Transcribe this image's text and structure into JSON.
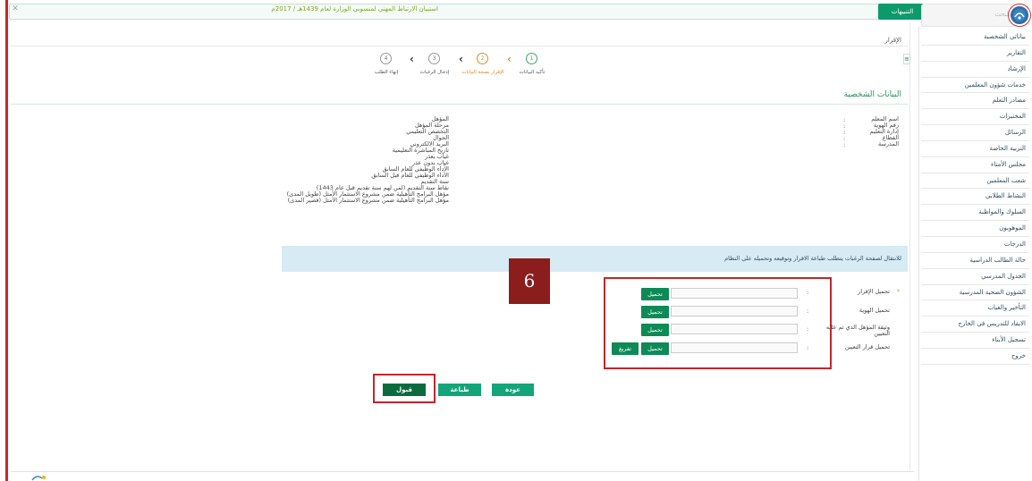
{
  "top_bar": {
    "ticker": "استبيان الارتباط المهني لمنسوبي الوزارة لعام 1439هـ / 2017م",
    "alerts_label": "التنبيهات"
  },
  "search": {
    "placeholder": "البحث"
  },
  "sidebar": {
    "items": [
      {
        "label": "بياناتي الشخصية"
      },
      {
        "label": "التقارير"
      },
      {
        "label": "الإرشاد"
      },
      {
        "label": "خدمات شؤون المعلمين"
      },
      {
        "label": "مصادر التعلم"
      },
      {
        "label": "المختبرات"
      },
      {
        "label": "الرسائل"
      },
      {
        "label": "التربية الخاصة"
      },
      {
        "label": "مجلس الأمناء"
      },
      {
        "label": "شعب المعلمين"
      },
      {
        "label": "النشاط الطلابي"
      },
      {
        "label": "السلوك والمواظبة"
      },
      {
        "label": "الموهوبون"
      },
      {
        "label": "الدرجات"
      },
      {
        "label": "حالة الطالب الدراسية"
      },
      {
        "label": "الجدول المدرسي"
      },
      {
        "label": "الشؤون الصحية المدرسية"
      },
      {
        "label": "التأخير والغياب"
      },
      {
        "label": "الايفاد للتدريس في الخارج"
      },
      {
        "label": "تسجيل الأبناء"
      },
      {
        "label": "خروج"
      }
    ]
  },
  "breadcrumb": "الإقرار",
  "wizard": {
    "steps": [
      {
        "number": "1",
        "label": "تأكيد البيانات"
      },
      {
        "number": "2",
        "label": "الإقرار بصحة البيانات"
      },
      {
        "number": "3",
        "label": "إدخال الرغبات"
      },
      {
        "number": "4",
        "label": "إنهاء الطلب"
      }
    ]
  },
  "section_title": "البيانات الشخصية",
  "personal_right": {
    "labels": [
      "اسم المعلم",
      "رقم الهوية",
      "إدارة التعليم",
      "القطاع",
      "المدرسة"
    ]
  },
  "personal_left": {
    "labels": [
      "المؤهل",
      "مرحلة المؤهل",
      "التخصص التعليمي",
      "الجوال",
      "البريد الالكتروني",
      "تاريخ المباشرة التعليمية",
      "غياب بعذر",
      "غياب بدون عذر",
      "الأداء الوظيفي للعام السابق",
      "الأداء الوظيفي للعام قبل السابق",
      "سنة التقديم",
      "نقاط سنة التقديم (لمن لهم سنة تقديم قبل عام 1443)",
      "مؤهل البرامج التأهيلية ضمن مشروع الاستثمار الأمثل (طويل المدى)",
      "مؤهل البرامج التأهيلية ضمن مشروع الاستثمار الأمثل (قصير المدى)"
    ]
  },
  "info_text": "للانتقال لصفحة الرغبات يتطلب طباعة الاقرار وتوقيعه وتحميله على النظام",
  "uploads": [
    {
      "label": "تحميل الإقرار",
      "button": "تحميل"
    },
    {
      "label": "تحميل الهوية",
      "button": "تحميل"
    },
    {
      "label": "وثيقة المؤهل الذي تم عليه التعيين",
      "button": "تحميل"
    },
    {
      "label": "تحميل قرار التعيين",
      "button": "تحميل",
      "extra_button": "تفريغ"
    }
  ],
  "annotation_badge": "6",
  "actions": {
    "back": "عودة",
    "print": "طباعة",
    "accept": "قبول"
  }
}
